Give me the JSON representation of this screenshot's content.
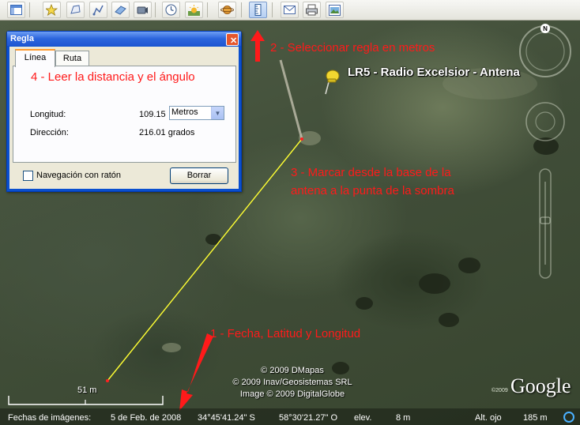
{
  "toolbar": {
    "buttons": [
      {
        "icon": "sidebar-icon"
      },
      {
        "icon": "placemark-icon"
      },
      {
        "icon": "polygon-icon"
      },
      {
        "icon": "path-icon"
      },
      {
        "icon": "image-overlay-icon"
      },
      {
        "icon": "record-tour-icon"
      },
      {
        "icon": "historical-imagery-icon"
      },
      {
        "icon": "sunlight-icon"
      },
      {
        "icon": "planets-icon"
      },
      {
        "icon": "ruler-icon"
      },
      {
        "icon": "email-icon"
      },
      {
        "icon": "print-icon"
      },
      {
        "icon": "save-image-icon"
      }
    ]
  },
  "annotations": {
    "step1": "1 - Fecha, Latitud y Longitud",
    "step2": "2 - Seleccionar regla en metros",
    "step3_line1": "3 - Marcar desde la base de la",
    "step3_line2": "antena a la punta de la sombra",
    "step4": "4 - Leer la distancia y el ángulo",
    "color": "#ff1a1a"
  },
  "map": {
    "placemark_label": "LR5 - Radio Excelsior - Antena",
    "measure_line_color": "#ffff33",
    "copyright_lines": [
      "© 2009 DMapas",
      "© 2009 Inav/Geosistemas SRL",
      "Image © 2009 DigitalGlobe"
    ],
    "scale_label": "51 m",
    "logo": "Google",
    "logo_year": "©2009"
  },
  "status_bar": {
    "imagery_label": "Fechas de imágenes:",
    "imagery_date": "5 de Feb. de 2008",
    "latitude": "34°45'41.24\" S",
    "longitude": "58°30'21.27\" O",
    "elev_label": "elev.",
    "elev_value": "8 m",
    "eye_label": "Alt. ojo",
    "eye_value": "185 m"
  },
  "dialog": {
    "title": "Regla",
    "close_glyph": "✕",
    "tabs": [
      {
        "label": "Línea",
        "active": true
      },
      {
        "label": "Ruta",
        "active": false
      }
    ],
    "longitud_label": "Longitud:",
    "longitud_value": "109.15",
    "unit_selected": "Metros",
    "direccion_label": "Dirección:",
    "direccion_value": "216.01 grados",
    "nav_checkbox_label": "Navegación con ratón",
    "nav_checkbox_checked": false,
    "clear_button": "Borrar"
  },
  "nav": {
    "north_letter": "N"
  }
}
